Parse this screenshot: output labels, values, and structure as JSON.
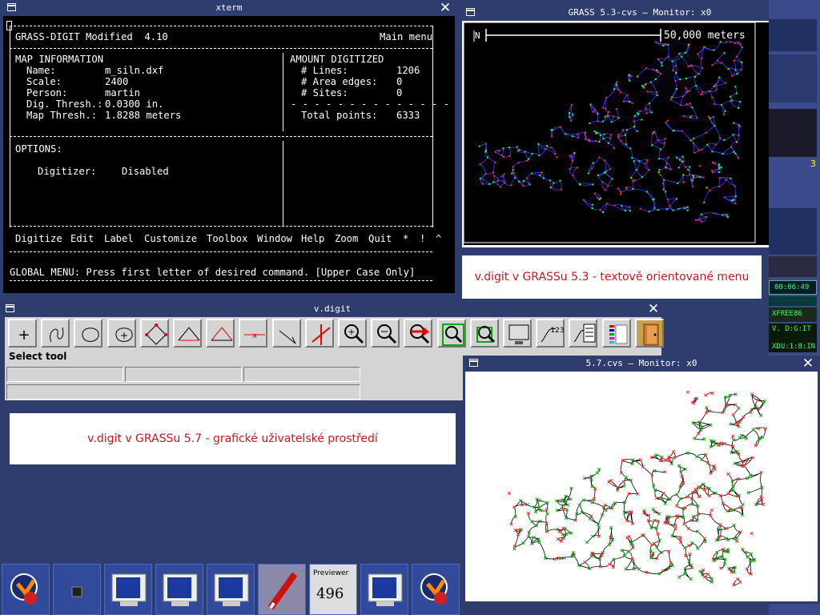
{
  "xterm": {
    "title": "xterm",
    "header_left": "GRASS-DIGIT Modified  4.10",
    "header_right": "Main menu",
    "map_info_title": "MAP INFORMATION",
    "map_info": [
      {
        "label": "Name:",
        "value": "m_siln.dxf"
      },
      {
        "label": "Scale:",
        "value": "2400"
      },
      {
        "label": "Person:",
        "value": "martin"
      },
      {
        "label": "Dig. Thresh.:",
        "value": "0.0300 in."
      },
      {
        "label": "Map Thresh.:",
        "value": "1.8288 meters"
      }
    ],
    "amount_title": "AMOUNT DIGITIZED",
    "amount": [
      {
        "label": "# Lines:",
        "value": "1206"
      },
      {
        "label": "# Area edges:",
        "value": "0"
      },
      {
        "label": "# Sites:",
        "value": "0"
      }
    ],
    "total_label": "Total points:",
    "total_value": "6333",
    "options_title": "OPTIONS:",
    "digitizer_label": "Digitizer:",
    "digitizer_value": "Disabled",
    "menu": [
      "Digitize",
      "Edit",
      "Label",
      "Customize",
      "Toolbox",
      "Window",
      "Help",
      "Zoom",
      "Quit",
      "*",
      "!",
      "^"
    ],
    "status": "GLOBAL MENU: Press first letter of desired command. [Upper Case Only]"
  },
  "monitor1": {
    "title": "GRASS 5.3-cvs – Monitor: x0",
    "scale_text": "50,000 meters",
    "north": "N"
  },
  "monitor2": {
    "title": "5.7.cvs – Monitor: x0"
  },
  "vdigit": {
    "title": "v.digit",
    "status_label": "Select tool",
    "tools": [
      "add-point",
      "add-line",
      "add-boundary",
      "add-centroid",
      "move-vertex",
      "add-vertex",
      "remove-vertex",
      "delete-line",
      "move-line",
      "split-line",
      "zoom-in",
      "zoom-out",
      "pan",
      "zoom-region",
      "zoom-default",
      "display-monitor",
      "attributes-table",
      "categories",
      "settings",
      "exit"
    ]
  },
  "captions": {
    "top": "v.digit v GRASSu 5.3 - textově orientované menu",
    "bottom": "v.digit v GRASSu 5.7 - grafické uživatelské prostředí"
  },
  "taskbar": {
    "previewer_label": "Previewer",
    "previewer_number": "496"
  },
  "right_panel": {
    "clock": "00:06:49",
    "xfree": "XFREE86",
    "vdigit_label": "V. D:G:IT",
    "xdu": "XDU:1:8:IN",
    "partial_digit": "3"
  },
  "colors": {
    "desktop": "#2e3c6e",
    "caption_text": "#c8181c",
    "map_lines_1": "#3b3bff",
    "map_nodes_1": "#ff3030",
    "map_points_1": "#30ff30",
    "map_lines_2": "#000000",
    "map_nodes_2": "#ff3030",
    "map_points_2": "#10a010"
  }
}
